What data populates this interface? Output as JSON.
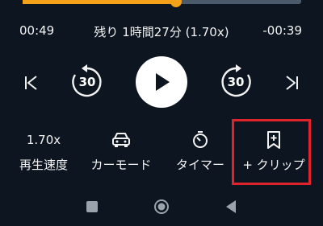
{
  "progress": {
    "fraction": 0.55
  },
  "time": {
    "elapsed": "00:49",
    "remaining_label": "残り 1時間27分 (1.70x)",
    "remaining": "-00:39"
  },
  "controls": {
    "skip_back_seconds": "30",
    "skip_forward_seconds": "30"
  },
  "options": {
    "speed_value": "1.70x",
    "speed_label": "再生速度",
    "car_label": "カーモード",
    "timer_label": "タイマー",
    "clip_label": "+ クリップ"
  },
  "colors": {
    "background": "#0d1620",
    "accent": "#f4a11a",
    "highlight": "#e0242b"
  },
  "icons": [
    "previous-chapter-icon",
    "rewind-30-icon",
    "play-icon",
    "forward-30-icon",
    "next-chapter-icon",
    "car-icon",
    "timer-icon",
    "bookmark-add-icon",
    "square-icon",
    "circle-icon",
    "triangle-back-icon"
  ]
}
